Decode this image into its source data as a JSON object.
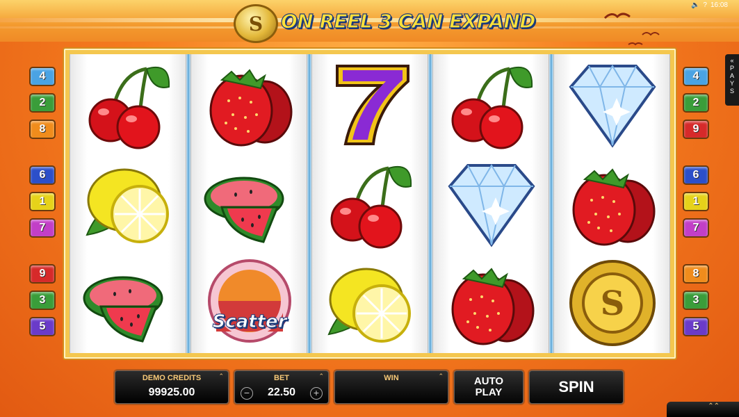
{
  "header": {
    "banner_text": "ON REEL 3 CAN EXPAND",
    "logo_letter": "S",
    "time": "16:08",
    "help_label": "?"
  },
  "reels": [
    [
      "cherries",
      "lemon",
      "watermelon"
    ],
    [
      "strawberry",
      "watermelon",
      "scatter"
    ],
    [
      "seven",
      "cherries",
      "lemon"
    ],
    [
      "cherries",
      "diamond",
      "strawberry"
    ],
    [
      "diamond",
      "strawberry",
      "gold-coin"
    ]
  ],
  "scatter_label": "Scatter",
  "paylines_left": [
    {
      "n": "4",
      "color": "#4aa3e3"
    },
    {
      "n": "2",
      "color": "#3a9d3a"
    },
    {
      "n": "8",
      "color": "#f08c1c"
    },
    {
      "n": "6",
      "color": "#2c4fc9"
    },
    {
      "n": "1",
      "color": "#e6d21a"
    },
    {
      "n": "7",
      "color": "#c23fc7"
    },
    {
      "n": "9",
      "color": "#d62a2a"
    },
    {
      "n": "3",
      "color": "#3a9d3a"
    },
    {
      "n": "5",
      "color": "#6a3bc9"
    }
  ],
  "paylines_right": [
    {
      "n": "4",
      "color": "#4aa3e3"
    },
    {
      "n": "2",
      "color": "#3a9d3a"
    },
    {
      "n": "9",
      "color": "#d62a2a"
    },
    {
      "n": "6",
      "color": "#2c4fc9"
    },
    {
      "n": "1",
      "color": "#e6d21a"
    },
    {
      "n": "7",
      "color": "#c23fc7"
    },
    {
      "n": "8",
      "color": "#f08c1c"
    },
    {
      "n": "3",
      "color": "#3a9d3a"
    },
    {
      "n": "5",
      "color": "#6a3bc9"
    }
  ],
  "pays_tab": {
    "label": "PAYS"
  },
  "controls": {
    "credits_label": "DEMO CREDITS",
    "credits_value": "99925.00",
    "bet_label": "BET",
    "bet_value": "22.50",
    "win_label": "WIN",
    "win_value": "",
    "autoplay_line1": "AUTO",
    "autoplay_line2": "PLAY",
    "spin_label": "SPIN"
  },
  "colors": {
    "background": "#f57c1f",
    "banner_text": "#ffe13a",
    "label_gold": "#f7c978"
  }
}
